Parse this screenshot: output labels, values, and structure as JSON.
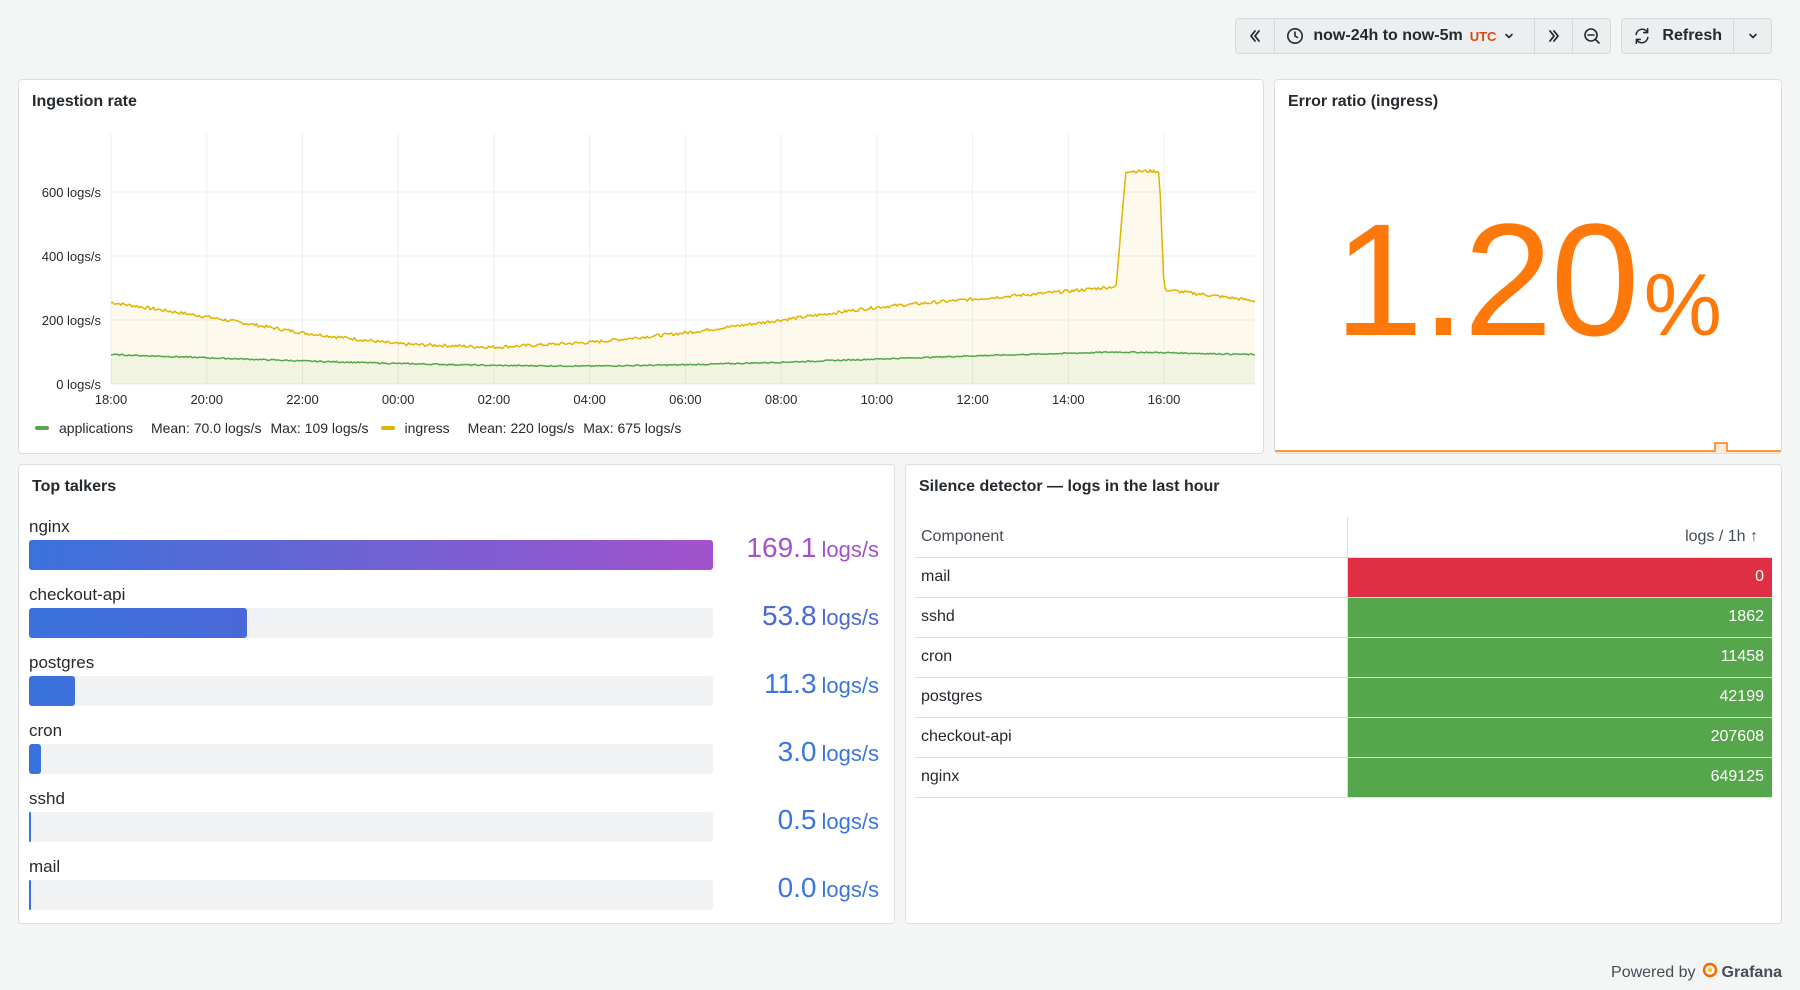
{
  "toolbar": {
    "time_range": "now-24h to now-5m",
    "timezone": "UTC",
    "refresh_label": "Refresh"
  },
  "ingestion": {
    "title": "Ingestion rate",
    "y_ticks": [
      "0 logs/s",
      "200 logs/s",
      "400 logs/s",
      "600 logs/s"
    ],
    "x_ticks": [
      "18:00",
      "20:00",
      "22:00",
      "00:00",
      "02:00",
      "04:00",
      "06:00",
      "08:00",
      "10:00",
      "12:00",
      "14:00",
      "16:00"
    ],
    "legend": [
      {
        "name": "applications",
        "mean": "Mean: 70.0 logs/s",
        "max": "Max: 109 logs/s",
        "color": "#56a64b"
      },
      {
        "name": "ingress",
        "mean": "Mean: 220 logs/s",
        "max": "Max: 675 logs/s",
        "color": "#e0b400"
      }
    ]
  },
  "chart_data": {
    "type": "line",
    "xlabel": "",
    "ylabel": "",
    "ylim": [
      0,
      750
    ],
    "x_unit": "hours since 18:00",
    "xlim": [
      0,
      23.9
    ],
    "series": [
      {
        "name": "applications",
        "color": "#56a64b",
        "x": [
          0,
          2,
          4,
          6,
          8,
          10,
          12,
          14,
          16,
          18,
          20,
          21,
          22,
          23.9
        ],
        "values": [
          92,
          82,
          72,
          64,
          58,
          56,
          60,
          68,
          78,
          88,
          96,
          100,
          98,
          92
        ]
      },
      {
        "name": "ingress",
        "color": "#e0b400",
        "x": [
          0,
          2,
          4,
          6,
          8,
          10,
          12,
          14,
          16,
          18,
          20,
          21,
          21.2,
          21.9,
          22,
          23.9
        ],
        "values": [
          255,
          210,
          160,
          125,
          115,
          130,
          160,
          200,
          240,
          265,
          290,
          305,
          665,
          665,
          295,
          260
        ]
      }
    ]
  },
  "error_ratio": {
    "title": "Error ratio (ingress)",
    "value": "1.20",
    "unit": "%",
    "color": "#ff780a"
  },
  "top_talkers": {
    "title": "Top talkers",
    "unit": "logs/s",
    "max": 169.1,
    "items": [
      {
        "name": "nginx",
        "value": 169.1,
        "display": "169.1",
        "color_start": "#3a72db",
        "color_end": "#a352cc",
        "text_color": "#a352cc"
      },
      {
        "name": "checkout-api",
        "value": 53.8,
        "display": "53.8",
        "color_start": "#3a72db",
        "color_end": "#4a68d8",
        "text_color": "#4a68d8"
      },
      {
        "name": "postgres",
        "value": 11.3,
        "display": "11.3",
        "color_start": "#3a72db",
        "color_end": "#3c70db",
        "text_color": "#3b76e0"
      },
      {
        "name": "cron",
        "value": 3.0,
        "display": "3.0",
        "color_start": "#3a72db",
        "color_end": "#3a72db",
        "text_color": "#3b76e0"
      },
      {
        "name": "sshd",
        "value": 0.5,
        "display": "0.5",
        "color_start": "#3a72db",
        "color_end": "#3a72db",
        "text_color": "#3b76e0"
      },
      {
        "name": "mail",
        "value": 0.0,
        "display": "0.0",
        "color_start": "#3a72db",
        "color_end": "#3a72db",
        "text_color": "#3b76e0"
      }
    ]
  },
  "silence": {
    "title": "Silence detector — logs in the last hour",
    "col_component": "Component",
    "col_value": "logs / 1h",
    "rows": [
      {
        "component": "mail",
        "value": "0",
        "color": "#e02f44"
      },
      {
        "component": "sshd",
        "value": "1862",
        "color": "#56a64b"
      },
      {
        "component": "cron",
        "value": "11458",
        "color": "#56a64b"
      },
      {
        "component": "postgres",
        "value": "42199",
        "color": "#56a64b"
      },
      {
        "component": "checkout-api",
        "value": "207608",
        "color": "#56a64b"
      },
      {
        "component": "nginx",
        "value": "649125",
        "color": "#56a64b"
      }
    ]
  },
  "footer": {
    "powered_by": "Powered by",
    "brand": "Grafana"
  }
}
